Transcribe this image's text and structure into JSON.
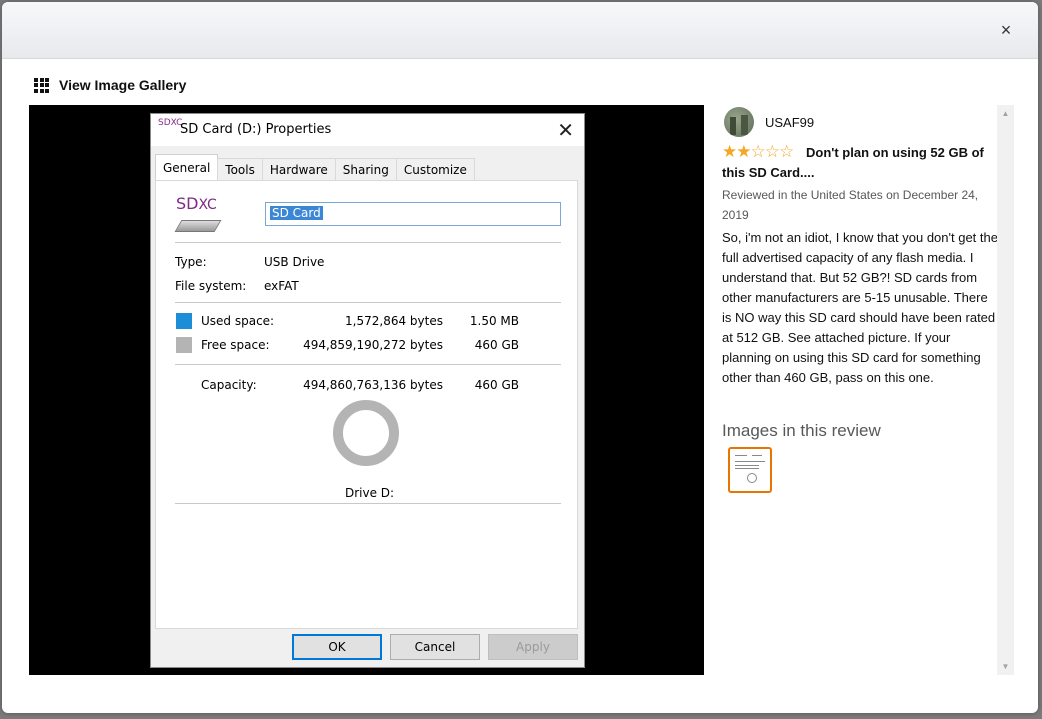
{
  "modal": {
    "close_glyph": "×",
    "gallery_label": "View Image Gallery"
  },
  "dialog": {
    "logo_small": "SDXC",
    "title": "SD Card (D:) Properties",
    "close_glyph": "✕",
    "tabs": [
      "General",
      "Tools",
      "Hardware",
      "Sharing",
      "Customize"
    ],
    "active_tab": "General",
    "logo_sd": "SD",
    "logo_xc": "XC",
    "name_value": "SD Card",
    "type_label": "Type:",
    "type_value": "USB Drive",
    "fs_label": "File system:",
    "fs_value": "exFAT",
    "used_label": "Used space:",
    "used_bytes": "1,572,864 bytes",
    "used_size": "1.50 MB",
    "used_color": "#1c8ed8",
    "free_label": "Free space:",
    "free_bytes": "494,859,190,272 bytes",
    "free_size": "460 GB",
    "free_color": "#b4b4b4",
    "capacity_label": "Capacity:",
    "capacity_bytes": "494,860,763,136 bytes",
    "capacity_size": "460 GB",
    "drive_label": "Drive D:",
    "ok": "OK",
    "cancel": "Cancel",
    "apply": "Apply"
  },
  "review": {
    "reviewer": "USAF99",
    "rating": 2,
    "rating_max": 5,
    "headline": "Don't plan on using 52 GB of this SD Card....",
    "meta": "Reviewed in the United States on December 24, 2019",
    "body": "So, i'm not an idiot, I know that you don't get the full advertised capacity of any flash media. I understand that. But 52 GB?! SD cards from other manufacturers are 5-15 unusable. There is NO way this SD card should have been rated at 512 GB. See attached picture. If your planning on using this SD card for something other than 460 GB, pass on this one.",
    "images_heading": "Images in this review",
    "star_color": "#f5a623",
    "thumb_border_color": "#e77600"
  },
  "scroll": {
    "up": "▲",
    "down": "▼"
  }
}
